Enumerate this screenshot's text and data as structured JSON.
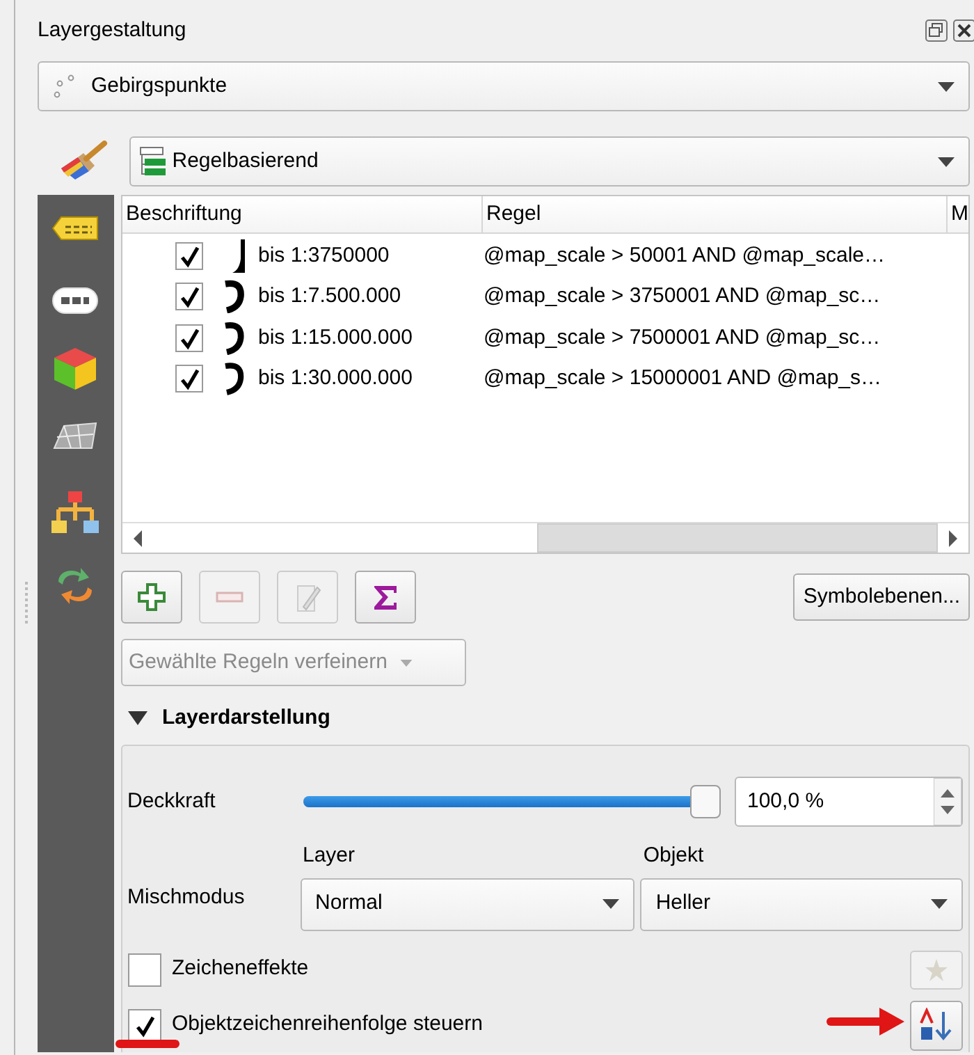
{
  "panel": {
    "title": "Layergestaltung"
  },
  "layer_combo": {
    "value": "Gebirgspunkte"
  },
  "renderer_combo": {
    "value": "Regelbasierend"
  },
  "rules_table": {
    "columns": [
      "Beschriftung",
      "Regel",
      "M"
    ],
    "rows": [
      {
        "checked": true,
        "label": "bis 1:3750000",
        "rule": "@map_scale > 50001 AND @map_scale…"
      },
      {
        "checked": true,
        "label": "bis 1:7.500.000",
        "rule": "@map_scale > 3750001 AND @map_sc…"
      },
      {
        "checked": true,
        "label": "bis 1:15.000.000",
        "rule": "@map_scale > 7500001 AND @map_sc…"
      },
      {
        "checked": true,
        "label": "bis 1:30.000.000",
        "rule": "@map_scale > 15000001 AND @map_s…"
      }
    ]
  },
  "tool_buttons": [
    {
      "kind": "add",
      "disabled": false
    },
    {
      "kind": "remove",
      "disabled": true
    },
    {
      "kind": "edit",
      "disabled": true
    },
    {
      "kind": "sum",
      "disabled": false
    }
  ],
  "symbol_levels_button": "Symbolebenen...",
  "refine_dropdown": {
    "value": "Gewählte Regeln verfeinern",
    "disabled": true
  },
  "layer_rendering": {
    "title": "Layerdarstellung",
    "expanded": true,
    "opacity": {
      "label": "Deckkraft",
      "level": 1.0,
      "value": "100,0 %"
    },
    "blend": {
      "label": "Mischmodus",
      "layer_label": "Layer",
      "layer_value": "Normal",
      "feature_label": "Objekt",
      "feature_value": "Heller"
    },
    "draw_effects": {
      "label": "Zeicheneffekte",
      "checked": false
    },
    "control_order": {
      "label": "Objektzeichenreihenfolge steuern",
      "checked": true
    }
  }
}
